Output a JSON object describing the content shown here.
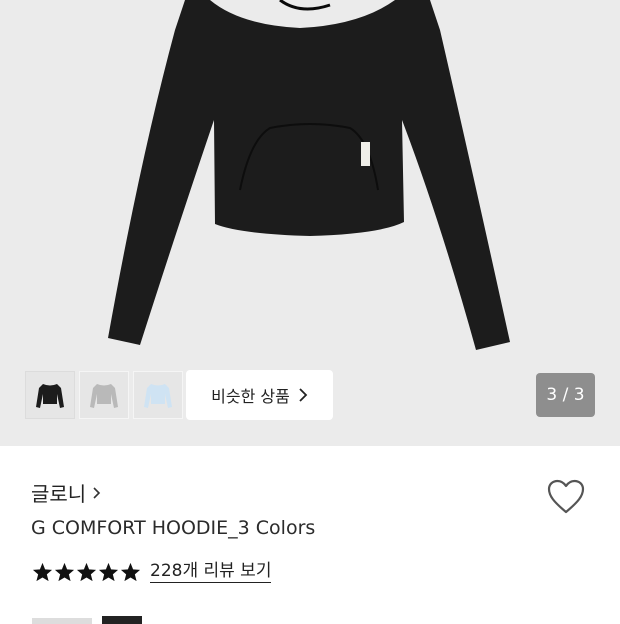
{
  "gallery": {
    "counter": "3 / 3",
    "similar_button_label": "비슷한 상품",
    "thumbnails": [
      {
        "name": "black"
      },
      {
        "name": "gray"
      },
      {
        "name": "sky-blue"
      }
    ],
    "colors": {
      "black": "#1c1c1c",
      "gray": "#b9b9b9",
      "sky_blue": "#cfe3f3",
      "background": "#ebebeb"
    }
  },
  "product": {
    "brand": "글로니",
    "title": "G COMFORT HOODIE_3 Colors",
    "rating_stars": 5,
    "review_link": "228개 리뷰 보기"
  },
  "icons": [
    "chevron-right-icon",
    "heart-icon",
    "star-icon"
  ]
}
